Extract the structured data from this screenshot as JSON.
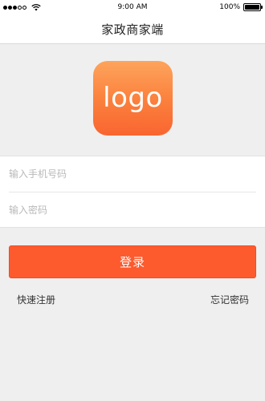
{
  "status_bar": {
    "time": "9:00 AM",
    "battery_label": "100%",
    "battery_level": 1.0,
    "signal_bars_filled": 3,
    "signal_bars_total": 5
  },
  "nav": {
    "title": "家政商家端"
  },
  "logo": {
    "text": "logo",
    "gradient_top": "#fda45c",
    "gradient_bottom": "#f96530"
  },
  "form": {
    "phone_placeholder": "输入手机号码",
    "phone_value": "",
    "password_placeholder": "输入密码",
    "password_value": ""
  },
  "actions": {
    "login_label": "登录",
    "register_label": "快速注册",
    "forgot_label": "忘记密码"
  },
  "colors": {
    "accent": "#fd5a2e",
    "background": "#efefef"
  }
}
